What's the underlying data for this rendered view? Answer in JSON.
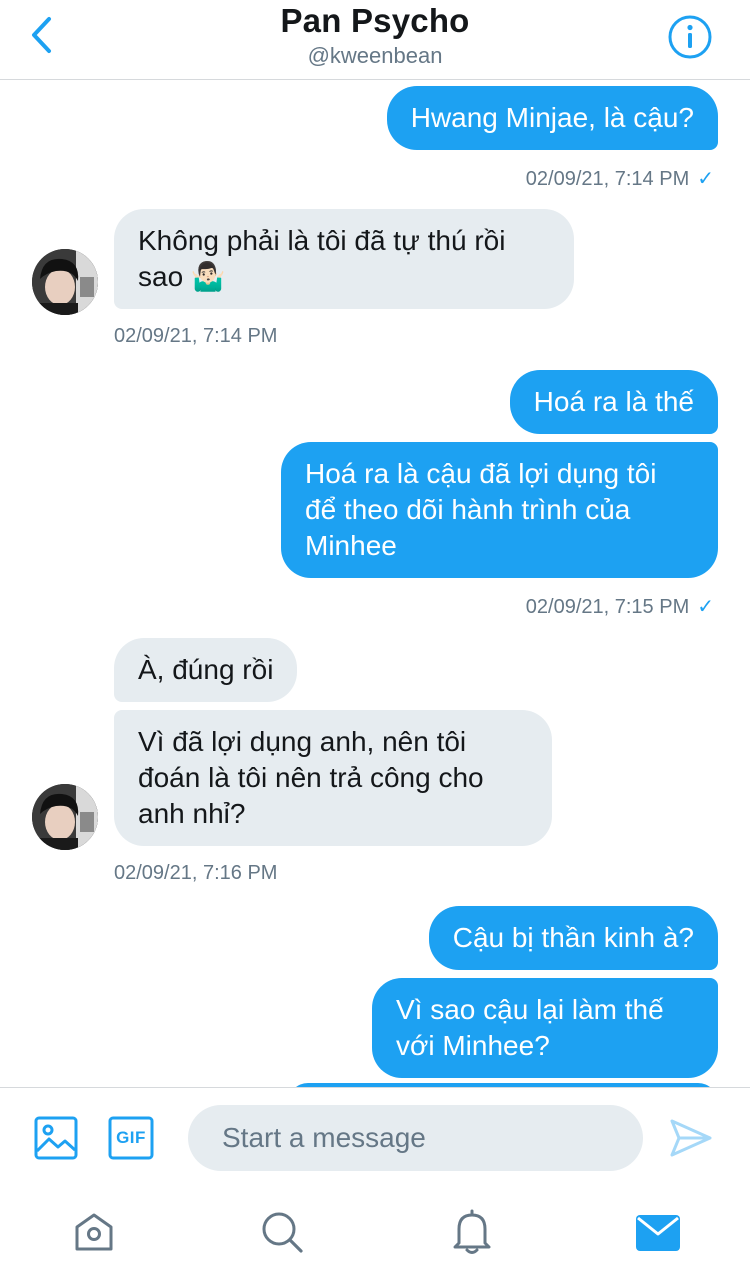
{
  "header": {
    "title": "Pan Psycho",
    "handle": "@kweenbean"
  },
  "messages": [
    {
      "direction": "out",
      "text": "Hwang Minjae, là cậu?"
    },
    {
      "direction": "meta",
      "text": "02/09/21, 7:14 PM",
      "check": "✓"
    },
    {
      "direction": "in",
      "text": "Không phải là tôi đã tự thú rồi sao 🤷🏻‍♂️"
    },
    {
      "direction": "meta",
      "text": "02/09/21, 7:14 PM"
    },
    {
      "direction": "out",
      "text": "Hoá ra là thế"
    },
    {
      "direction": "out",
      "text": "Hoá ra là cậu đã lợi dụng tôi để theo dõi hành trình của Minhee"
    },
    {
      "direction": "meta",
      "text": "02/09/21, 7:15 PM",
      "check": "✓"
    },
    {
      "direction": "in",
      "text": "À, đúng rồi"
    },
    {
      "direction": "in",
      "text": "Vì đã lợi dụng anh, nên tôi đoán là tôi nên trả công cho anh nhỉ?"
    },
    {
      "direction": "meta",
      "text": "02/09/21, 7:16 PM"
    },
    {
      "direction": "out",
      "text": "Cậu bị thần kinh à?"
    },
    {
      "direction": "out",
      "text": "Vì sao cậu lại làm thế với Minhee?"
    }
  ],
  "composer": {
    "placeholder": "Start a message",
    "gif_label": "GIF"
  },
  "icons": {
    "back": "chevron-left-icon",
    "info": "info-icon",
    "image": "image-icon",
    "gif": "gif-icon",
    "send": "send-icon",
    "home": "home-icon",
    "search": "search-icon",
    "notifications": "bell-icon",
    "messages": "mail-icon"
  },
  "colors": {
    "accent": "#1da1f2",
    "bubble_in": "#e6ecf0",
    "muted": "#657786"
  }
}
